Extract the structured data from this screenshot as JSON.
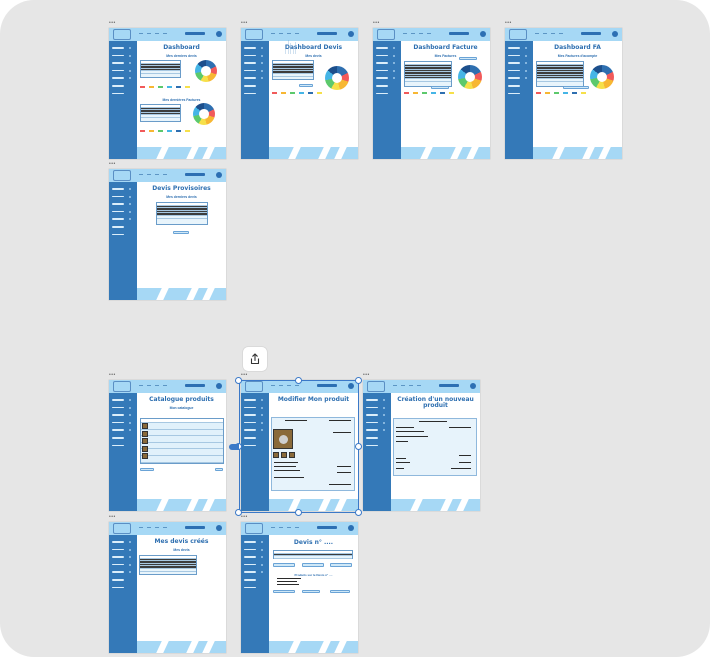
{
  "frames": [
    {
      "id": "dashboard",
      "title": "Dashboard",
      "subtitle": "Mes derniers devis",
      "subtitle2": "Mes dernières Factures",
      "label": "•••"
    },
    {
      "id": "dashboard-devis",
      "title": "Dashboard Devis",
      "subtitle": "Mes devis",
      "label": "•••"
    },
    {
      "id": "dashboard-facture",
      "title": "Dashboard Facture",
      "subtitle": "Mes Factures",
      "label": "•••"
    },
    {
      "id": "dashboard-fa",
      "title": "Dashboard FA",
      "subtitle": "Mes Factures d'acompte",
      "label": "•••"
    },
    {
      "id": "devis-provisoires",
      "title": "Devis Provisoires",
      "subtitle": "Mes derniers devis",
      "label": "•••"
    },
    {
      "id": "catalogue-produits",
      "title": "Catalogue produits",
      "subtitle": "Mon catalogue",
      "label": "•••"
    },
    {
      "id": "modifier-produit",
      "title": "Modifier Mon produit",
      "subtitle": "",
      "label": "•••"
    },
    {
      "id": "creation-produit",
      "title": "Création d'un nouveau produit",
      "subtitle": "",
      "label": "•••"
    },
    {
      "id": "mes-devis-crees",
      "title": "Mes devis créés",
      "subtitle": "Mes devis",
      "label": "•••"
    },
    {
      "id": "devis-n",
      "title": "Devis n° ....",
      "subtitle": "Produits sur le Devis n° ....",
      "label": "•••"
    }
  ],
  "icons": {
    "share": "share-icon",
    "user": "user-icon",
    "logo": "logo-icon"
  },
  "colors": {
    "canvas": "#e6e6e6",
    "sidebar": "#3479b8",
    "header": "#a6d8f5",
    "title": "#2e6fb0",
    "selection": "#3b79c8"
  }
}
